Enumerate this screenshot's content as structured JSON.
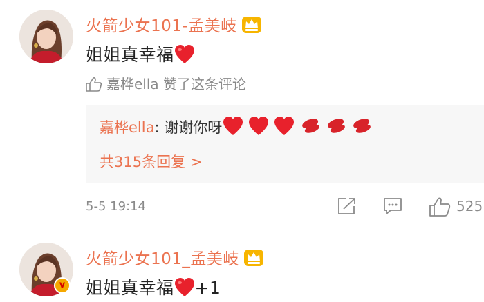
{
  "comment1": {
    "username": "火箭少女101-孟美岐",
    "text": "姐姐真幸福",
    "like_line": "嘉桦ella 赞了这条评论",
    "reply": {
      "author": "嘉桦ella",
      "separator": ": ",
      "text": "谢谢你呀",
      "total": "共315条回复 >"
    },
    "time": "5-5 19:14",
    "like_count": "525"
  },
  "comment2": {
    "username": "火箭少女101_孟美岐",
    "text": "姐姐真幸福",
    "suffix": "+1",
    "badge": "v"
  },
  "colors": {
    "accent": "#eb7350",
    "muted": "#8a8a8a",
    "reply_bg": "#f7f7f7",
    "heart": "#e8212c"
  },
  "icons": [
    "crown-badge-icon",
    "heart-emoji-icon",
    "kiss-emoji-icon",
    "thumb-up-icon",
    "share-icon",
    "comment-icon",
    "verified-badge-icon"
  ]
}
